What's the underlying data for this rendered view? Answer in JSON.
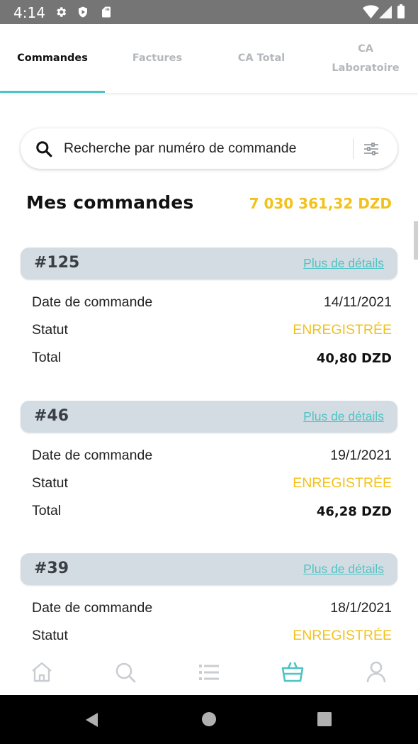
{
  "status_bar": {
    "time": "4:14",
    "left_icons": [
      "gear-icon",
      "shield-icon",
      "sd-card-icon"
    ],
    "right_icons": [
      "wifi-icon",
      "signal-icon",
      "battery-icon"
    ]
  },
  "tabs": [
    {
      "label": "Commandes",
      "active": true
    },
    {
      "label": "Factures",
      "active": false
    },
    {
      "label": "CA Total",
      "active": false
    },
    {
      "label_line1": "CA",
      "label_line2": "Laboratoire",
      "active": false
    }
  ],
  "search": {
    "placeholder": "Recherche par numéro de commande"
  },
  "heading": {
    "title": "Mes commandes",
    "total": "7 030 361,32 DZD"
  },
  "orders": [
    {
      "id": "#125",
      "link": "Plus de détails",
      "date_label": "Date de commande",
      "date": "14/11/2021",
      "status_label": "Statut",
      "status": "ENREGISTRÉE",
      "total_label": "Total",
      "total": "40,80 DZD"
    },
    {
      "id": "#46",
      "link": "Plus de détails",
      "date_label": "Date de commande",
      "date": "19/1/2021",
      "status_label": "Statut",
      "status": "ENREGISTRÉE",
      "total_label": "Total",
      "total": "46,28 DZD"
    },
    {
      "id": "#39",
      "link": "Plus de détails",
      "date_label": "Date de commande",
      "date": "18/1/2021",
      "status_label": "Statut",
      "status": "ENREGISTRÉE"
    }
  ],
  "bottom_nav": [
    {
      "icon": "home-icon",
      "active": false
    },
    {
      "icon": "search-icon",
      "active": false
    },
    {
      "icon": "list-icon",
      "active": false
    },
    {
      "icon": "basket-icon",
      "active": true
    },
    {
      "icon": "user-icon",
      "active": false
    }
  ],
  "colors": {
    "accent": "#4fc3c5",
    "amount": "#f2c21b",
    "card_header": "#d3dce2",
    "inactive_icon": "#c9cdd1"
  }
}
